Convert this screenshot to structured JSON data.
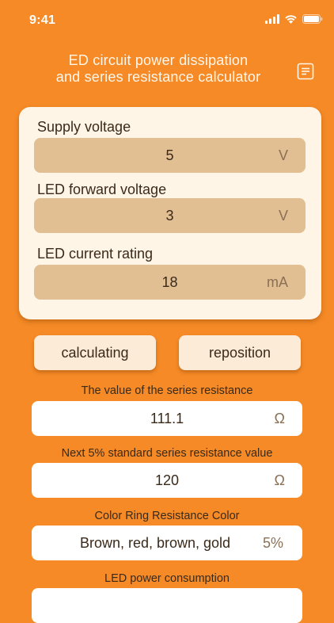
{
  "status_bar": {
    "time": "9:41"
  },
  "header": {
    "title_line1": "ED circuit power dissipation",
    "title_line2": "and series resistance calculator"
  },
  "inputs": [
    {
      "label": "Supply voltage",
      "value": "5",
      "unit": "V"
    },
    {
      "label": "LED forward voltage",
      "value": "3",
      "unit": "V"
    },
    {
      "label": "LED current rating",
      "value": "18",
      "unit": "mA"
    }
  ],
  "buttons": {
    "calculate": "calculating",
    "reset": "reposition"
  },
  "results": [
    {
      "label": "The value of the series resistance",
      "value": "111.1",
      "unit": "Ω"
    },
    {
      "label": "Next 5% standard series resistance value",
      "value": "120",
      "unit": "Ω"
    },
    {
      "label": "Color Ring Resistance Color",
      "value": "Brown, red, brown, gold",
      "unit": "5%"
    },
    {
      "label": "LED power consumption",
      "value": "",
      "unit": ""
    }
  ],
  "colors": {
    "background": "#F58A26",
    "card": "#FFF5E6",
    "input": "#E2BE93",
    "button": "#FCEBD6"
  }
}
